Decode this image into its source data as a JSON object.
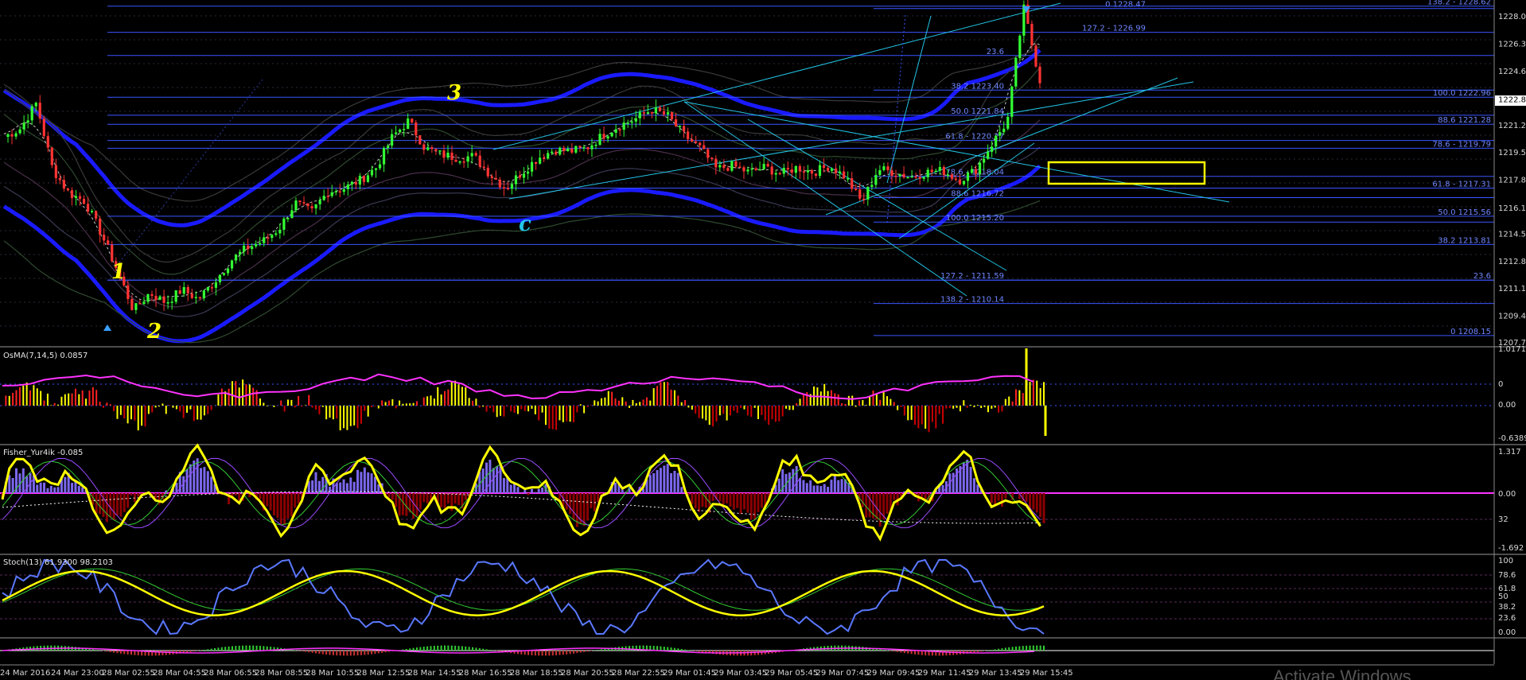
{
  "chart_data": {
    "type": "candlestick",
    "colors": {
      "bull": "#33ff33",
      "bear": "#ff3333",
      "fib_line": "#3a55ff",
      "fib_text": "#6f86ff",
      "channel": "#23c4e6",
      "envelope": "#1a1aff",
      "yellow": "#ffff00",
      "magenta": "#ff33ff",
      "osma_dark": "#cc0000",
      "fisher_hist": "#7b68ee",
      "stoch_blue": "#5a78ff"
    },
    "price_axis": {
      "ylim": [
        1207.5,
        1229.0
      ],
      "ticks": [
        "1228.00",
        "1226.30",
        "1224.60",
        "1222.85",
        "1221.25",
        "1219.55",
        "1217.85",
        "1216.10",
        "1214.50",
        "1212.80",
        "1211.10",
        "1209.40",
        "1207.75"
      ],
      "current_price": "1222.85"
    },
    "time_labels": [
      "24 Mar 2016",
      "24 Mar 23:00",
      "28 Mar 02:55",
      "28 Mar 04:55",
      "28 Mar 06:55",
      "28 Mar 08:55",
      "28 Mar 10:55",
      "28 Mar 12:55",
      "28 Mar 14:55",
      "28 Mar 16:55",
      "28 Mar 18:55",
      "28 Mar 20:55",
      "28 Mar 22:55",
      "29 Mar 01:45",
      "29 Mar 03:45",
      "29 Mar 05:45",
      "29 Mar 07:45",
      "29 Mar 09:45",
      "29 Mar 11:45",
      "29 Mar 13:45",
      "29 Mar 15:45"
    ],
    "price_path": [
      1220.5,
      1221.0,
      1222.6,
      1218.5,
      1217.0,
      1216.5,
      1214.5,
      1212.2,
      1209.7,
      1210.8,
      1210.2,
      1211.0,
      1210.4,
      1211.5,
      1212.8,
      1213.6,
      1214.0,
      1214.8,
      1216.4,
      1215.8,
      1217.1,
      1217.3,
      1217.8,
      1218.6,
      1220.5,
      1221.5,
      1219.8,
      1219.4,
      1219.2,
      1219.3,
      1218.2,
      1217.3,
      1218.3,
      1219.2,
      1219.7,
      1219.6,
      1219.8,
      1220.6,
      1221.2,
      1221.6,
      1222.2,
      1221.8,
      1220.6,
      1219.8,
      1218.5,
      1218.7,
      1218.3,
      1218.6,
      1218.2,
      1218.6,
      1218.3,
      1218.7,
      1218.0,
      1216.4,
      1218.5,
      1218.3,
      1218.0,
      1218.3,
      1218.4,
      1217.8,
      1218.4,
      1220.0,
      1221.5,
      1228.5,
      1224.0
    ],
    "fib_labels": [
      {
        "text": "0 1228.47",
        "price": 1228.47
      },
      {
        "text": "138.2 - 1228.62",
        "price": 1228.62
      },
      {
        "text": "127.2 - 1226.99",
        "price": 1226.99
      },
      {
        "text": "23.6",
        "price": 1225.55
      },
      {
        "text": "38.2 1223.40",
        "price": 1223.4
      },
      {
        "text": "100.0 1222.96",
        "price": 1222.96
      },
      {
        "text": "50.0 1221.84",
        "price": 1221.84
      },
      {
        "text": "88.6 1221.28",
        "price": 1221.28
      },
      {
        "text": "61.8 - 1220.27",
        "price": 1220.27
      },
      {
        "text": "78.6 - 1219.79",
        "price": 1219.79
      },
      {
        "text": "78.6 - 1218.04",
        "price": 1218.04
      },
      {
        "text": "61.8 - 1217.31",
        "price": 1217.31
      },
      {
        "text": "88.6 1216.72",
        "price": 1216.72
      },
      {
        "text": "50.0 1215.56",
        "price": 1215.56
      },
      {
        "text": "100.0 1215.20",
        "price": 1215.2
      },
      {
        "text": "38.2 1213.81",
        "price": 1213.81
      },
      {
        "text": "127.2 - 1211.59",
        "price": 1211.59
      },
      {
        "text": "23.6",
        "price": 1211.59
      },
      {
        "text": "138.2 - 1210.14",
        "price": 1210.14
      },
      {
        "text": "0 1208.15",
        "price": 1208.15
      }
    ],
    "wave_labels": [
      "1",
      "2",
      "3",
      "c"
    ],
    "subpanels": [
      {
        "name": "OsMA(7,14,5) 0.0857",
        "ticks": [
          "1.0171",
          "0",
          "0.00",
          "-0.6389"
        ]
      },
      {
        "name": "Fisher_Yur4ik -0.085",
        "ticks": [
          "1.317",
          "0.00",
          "32",
          "-1.692"
        ]
      },
      {
        "name": "Stoch(13) 61.9300 98.2103",
        "ticks": [
          "100",
          "78.6",
          "61.8",
          "50",
          "38.2",
          "23.6",
          "0.00"
        ]
      },
      {
        "name": "",
        "ticks": []
      }
    ]
  },
  "watermark": "Activate Windows"
}
